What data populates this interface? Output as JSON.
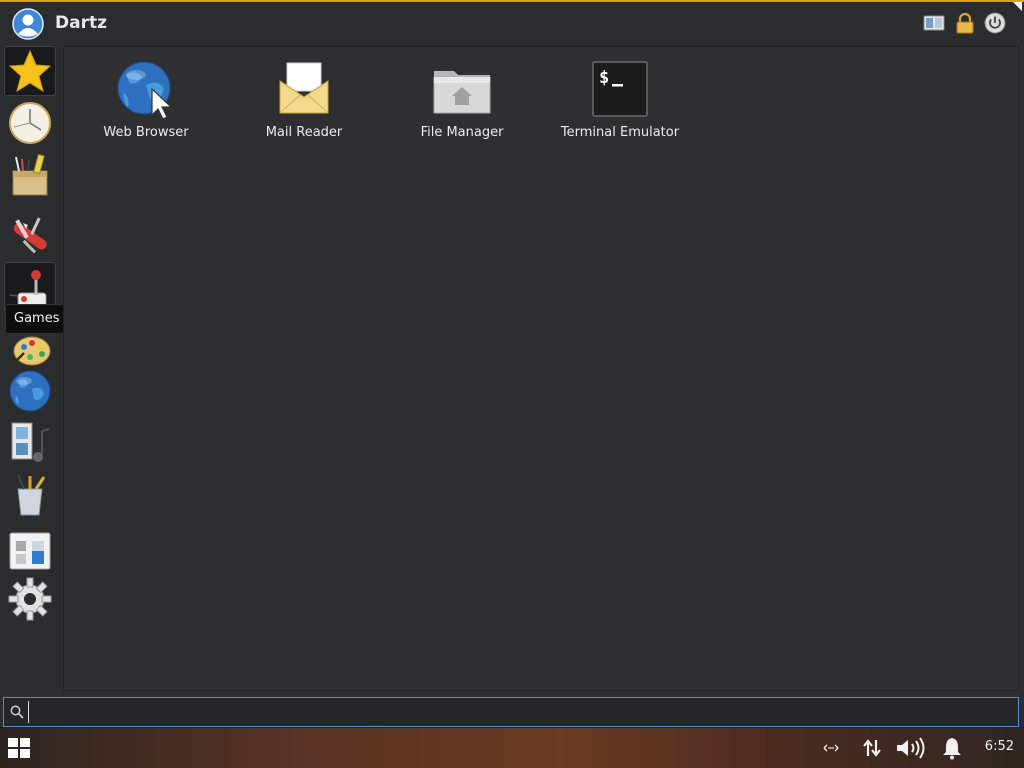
{
  "header": {
    "username": "Dartz",
    "buttons": [
      "switch-user-icon",
      "lock-icon",
      "power-icon"
    ]
  },
  "sidebar": {
    "categories": [
      {
        "name": "favorites",
        "icon": "star-icon"
      },
      {
        "name": "recently-used",
        "icon": "clock-icon"
      },
      {
        "name": "accessories",
        "icon": "accessories-icon"
      },
      {
        "name": "development",
        "icon": "swiss-knife-icon"
      },
      {
        "name": "games",
        "icon": "joystick-icon",
        "active": true
      },
      {
        "name": "graphics",
        "icon": "palette-icon"
      },
      {
        "name": "internet",
        "icon": "globe-icon"
      },
      {
        "name": "multimedia",
        "icon": "multimedia-icon"
      },
      {
        "name": "office",
        "icon": "pencil-cup-icon"
      },
      {
        "name": "settings",
        "icon": "settings-manager-icon"
      },
      {
        "name": "system",
        "icon": "gear-icon"
      }
    ],
    "tooltip": "Games"
  },
  "apps": [
    {
      "label": "Web Browser",
      "icon": "web-browser-icon"
    },
    {
      "label": "Mail Reader",
      "icon": "mail-icon"
    },
    {
      "label": "File Manager",
      "icon": "folder-home-icon"
    },
    {
      "label": "Terminal Emulator",
      "icon": "terminal-icon"
    }
  ],
  "search": {
    "value": "",
    "placeholder": ""
  },
  "taskbar": {
    "clock": "6:52",
    "tray": [
      "network-icon",
      "transfer-icon",
      "volume-icon",
      "notification-icon"
    ]
  },
  "colors": {
    "accent": "#4a90d9",
    "top_border": "#d9a21b",
    "menu_bg": "#2b2c2d",
    "content_bg": "#2e2f30"
  }
}
